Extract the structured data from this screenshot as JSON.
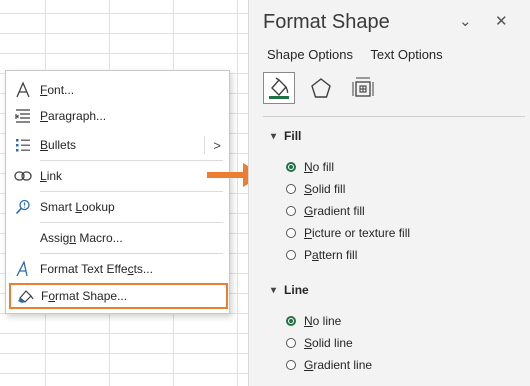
{
  "context_menu": {
    "items": [
      {
        "name": "font",
        "accel": "F",
        "rest": "ont..."
      },
      {
        "name": "paragraph",
        "accel": "P",
        "rest": "aragraph..."
      },
      {
        "name": "bullets",
        "accel": "B",
        "rest": "ullets",
        "submenu": ">"
      },
      {
        "name": "link",
        "accel": "L",
        "rest": "ink"
      },
      {
        "name": "smart-lookup",
        "accel": "",
        "pre": "Smart ",
        "accel2": "L",
        "rest": "ookup"
      },
      {
        "name": "assign-macro",
        "accel": "",
        "pre": "Assig",
        "accel2": "n",
        "rest": " Macro..."
      },
      {
        "name": "format-text-effects",
        "accel": "",
        "pre": "Format Text Effe",
        "accel2": "c",
        "rest": "ts..."
      },
      {
        "name": "format-shape",
        "accel": "",
        "pre": "F",
        "accel2": "o",
        "rest": "rmat Shape..."
      }
    ],
    "highlight_color": "#ed7d31"
  },
  "arrow_color": "#ed7d31",
  "pane": {
    "title": "Format Shape",
    "dropdown_glyph": "⌄",
    "close_glyph": "✕",
    "tabs": [
      "Shape Options",
      "Text Options"
    ],
    "icon_tabs": [
      "fill-line-icon",
      "effects-pentagon-icon",
      "size-properties-icon"
    ],
    "fill": {
      "heading": "Fill",
      "options": [
        {
          "accel": "N",
          "rest": "o fill",
          "selected": true
        },
        {
          "accel": "S",
          "rest": "olid fill",
          "selected": false
        },
        {
          "accel": "G",
          "rest": "radient fill",
          "selected": false
        },
        {
          "accel": "P",
          "rest": "icture or texture fill",
          "selected": false
        },
        {
          "pre": "P",
          "accel": "a",
          "rest": "ttern fill",
          "selected": false
        }
      ]
    },
    "line": {
      "heading": "Line",
      "options": [
        {
          "accel": "N",
          "rest": "o line",
          "selected": true
        },
        {
          "accel": "S",
          "rest": "olid line",
          "selected": false
        },
        {
          "accel": "G",
          "rest": "radient line",
          "selected": false
        }
      ]
    },
    "accent_color": "#217346"
  }
}
